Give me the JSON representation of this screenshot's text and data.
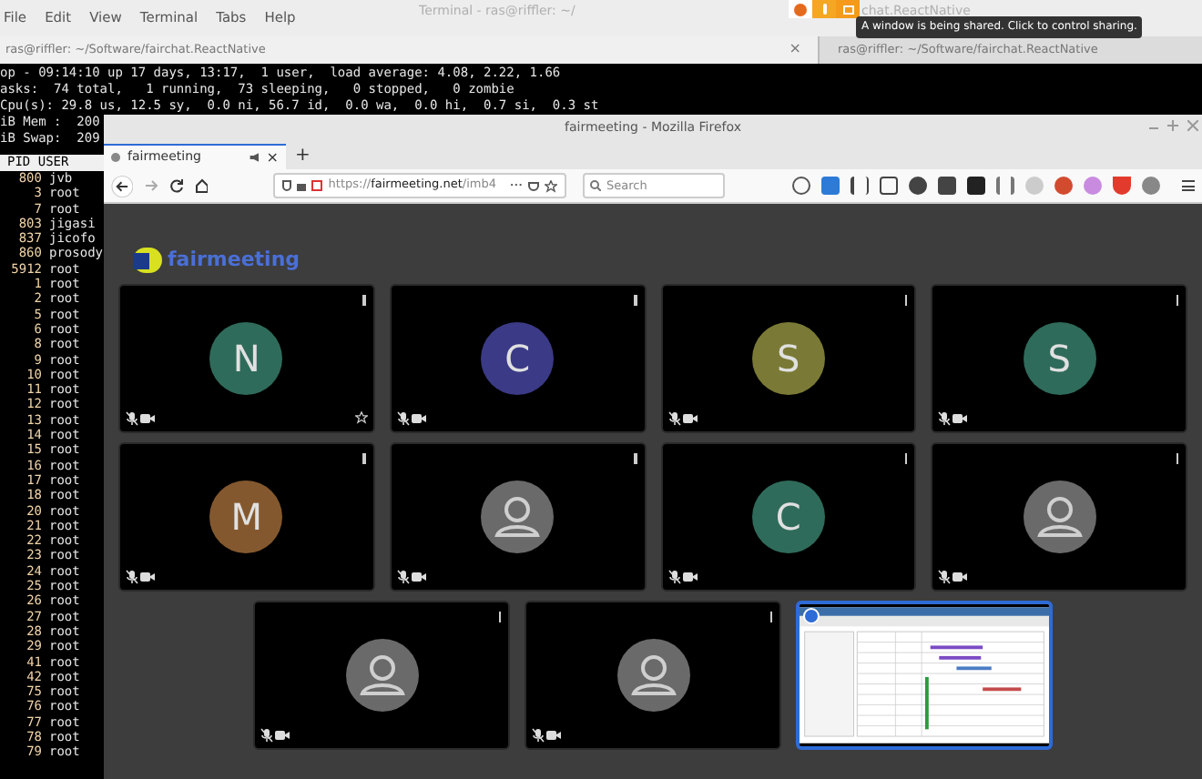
{
  "terminal": {
    "title_left": "Terminal - ras@riffler: ~/",
    "title_right": "chat.ReactNative",
    "menu": [
      "File",
      "Edit",
      "View",
      "Terminal",
      "Tabs",
      "Help"
    ],
    "tabs": [
      {
        "label": "ras@riffler: ~/Software/fairchat.ReactNative",
        "selected": true,
        "close": "×"
      },
      {
        "label": "ras@riffler: ~/Software/fairchat.ReactNative",
        "selected": false
      }
    ],
    "summary": [
      "op - 09:14:10 up 17 days, 13:17,  1 user,  load average: 4.08, 2.22, 1.66",
      "asks:  74 total,   1 running,  73 sleeping,   0 stopped,   0 zombie",
      "Cpu(s): 29.8 us, 12.5 sy,  0.0 ni, 56.7 id,  0.0 wa,  0.0 hi,  0.7 si,  0.3 st",
      "iB Mem :  200",
      "iB Swap:  209"
    ],
    "header": "PID USER",
    "processes": [
      [
        "800",
        "jvb"
      ],
      [
        "3",
        "root"
      ],
      [
        "7",
        "root"
      ],
      [
        "803",
        "jigasi"
      ],
      [
        "837",
        "jicofo"
      ],
      [
        "860",
        "prosody"
      ],
      [
        "5912",
        "root"
      ],
      [
        "1",
        "root"
      ],
      [
        "2",
        "root"
      ],
      [
        "5",
        "root"
      ],
      [
        "6",
        "root"
      ],
      [
        "8",
        "root"
      ],
      [
        "9",
        "root"
      ],
      [
        "10",
        "root"
      ],
      [
        "11",
        "root"
      ],
      [
        "12",
        "root"
      ],
      [
        "13",
        "root"
      ],
      [
        "14",
        "root"
      ],
      [
        "15",
        "root"
      ],
      [
        "16",
        "root"
      ],
      [
        "17",
        "root"
      ],
      [
        "18",
        "root"
      ],
      [
        "20",
        "root"
      ],
      [
        "21",
        "root"
      ],
      [
        "22",
        "root"
      ],
      [
        "23",
        "root"
      ],
      [
        "24",
        "root"
      ],
      [
        "25",
        "root"
      ],
      [
        "26",
        "root"
      ],
      [
        "27",
        "root"
      ],
      [
        "28",
        "root"
      ],
      [
        "29",
        "root"
      ],
      [
        "41",
        "root"
      ],
      [
        "42",
        "root"
      ],
      [
        "75",
        "root"
      ],
      [
        "76",
        "root"
      ],
      [
        "77",
        "root"
      ],
      [
        "78",
        "root"
      ],
      [
        "79",
        "root"
      ]
    ]
  },
  "sharing": {
    "tooltip": "A window is being shared. Click to control sharing."
  },
  "firefox": {
    "title": "fairmeeting - Mozilla Firefox",
    "tab": {
      "label": "fairmeeting",
      "close": "×"
    },
    "new_tab": "+",
    "url_prefix": "https://",
    "url_domain": "fairmeeting.net",
    "url_path": "/imb4",
    "search": {
      "placeholder": "Search"
    },
    "menu_dots": "•••"
  },
  "meeting": {
    "logo": "fairmeeting",
    "rows": [
      [
        {
          "kind": "initial",
          "initial": "N",
          "color": "#2f6b5a",
          "pinned": true,
          "selected": false
        },
        {
          "kind": "initial",
          "initial": "C",
          "color": "#3b3a86",
          "pinned": false,
          "selected": false
        },
        {
          "kind": "initial",
          "initial": "S",
          "color": "#7a7a36",
          "pinned": false,
          "selected": false
        },
        {
          "kind": "initial",
          "initial": "S",
          "color": "#2f6b5a",
          "pinned": false,
          "selected": false
        }
      ],
      [
        {
          "kind": "initial",
          "initial": "M",
          "color": "#84582e",
          "pinned": false,
          "selected": false
        },
        {
          "kind": "placeholder",
          "pinned": false,
          "selected": false
        },
        {
          "kind": "initial",
          "initial": "C",
          "color": "#2f6b5a",
          "pinned": false,
          "selected": false
        },
        {
          "kind": "placeholder",
          "pinned": false,
          "selected": false
        }
      ],
      [
        {
          "kind": "placeholder",
          "pinned": false,
          "selected": false
        },
        {
          "kind": "placeholder",
          "pinned": false,
          "selected": false
        },
        {
          "kind": "screen",
          "pinned": false,
          "selected": true
        }
      ]
    ]
  }
}
